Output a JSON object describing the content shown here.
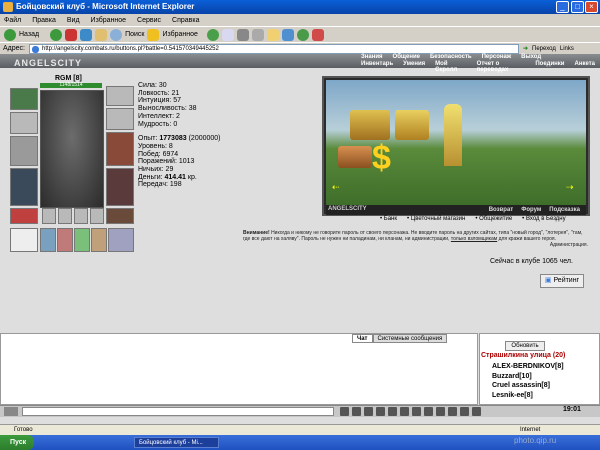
{
  "window": {
    "title": "Бойцовский клуб - Microsoft Internet Explorer"
  },
  "menu": [
    "Файл",
    "Правка",
    "Вид",
    "Избранное",
    "Сервис",
    "Справка"
  ],
  "toolbar": {
    "back": "Назад",
    "search": "Поиск",
    "favorites": "Избранное"
  },
  "address": {
    "label": "Адрес:",
    "url": "http://angelscity.combats.ru/buttons.pl?battle=0.541570349445252",
    "go": "Переход",
    "links": "Links"
  },
  "site": {
    "logo": "ANGELSCITY",
    "nav_top": [
      "Знания",
      "Общение",
      "Безопасность",
      "Персонаж",
      "Выход"
    ],
    "nav_bottom": [
      "Инвентарь",
      "Умения",
      "Мой Скролл",
      "Отчет о переводах",
      "Поединки",
      "Анкета"
    ]
  },
  "character": {
    "name": "RGM [8]",
    "hp": "1148/1514",
    "stats": [
      {
        "label": "Сила:",
        "value": "30"
      },
      {
        "label": "Ловкость:",
        "value": "21"
      },
      {
        "label": "Интуиция:",
        "value": "57"
      },
      {
        "label": "Выносливость:",
        "value": "38"
      },
      {
        "label": "Интеллект:",
        "value": "2"
      },
      {
        "label": "Мудрость:",
        "value": "0"
      }
    ],
    "exp_label": "Опыт:",
    "exp_value": "1773083",
    "exp_next": "(2000000)",
    "level": "Уровень: 8",
    "wins": "Побед: 6974",
    "losses": "Поражений: 1013",
    "draws": "Ничьих: 29",
    "money_label": "Деньги:",
    "money_value": "414.41",
    "money_unit": "кр.",
    "transfers": "Передач: 198"
  },
  "game": {
    "logo": "ANGELSCITY",
    "bar_links": [
      "Возврат",
      "Форум",
      "Подсказка"
    ],
    "links": [
      "Банк",
      "Цветочный магазин",
      "Общежитие",
      "Вход в Бездну"
    ]
  },
  "warning": {
    "bold": "Внимание!",
    "text": "Никогда и никому не говорите пароль от своего персонажа. Не вводите пароль на других сайтах, типа \"новый город\", \"лотерея\", \"там, где все дают на халяву\". Пароль не нужен ни паладинам, ни кланам, ни администрации,",
    "link": "только взломщикам",
    "tail": "для кражи вашего героя.",
    "sign": "Администрация."
  },
  "online": "Сейчас в клубе 1065 чел.",
  "rating_button": "Рейтинг",
  "chat": {
    "tabs": [
      "Чат",
      "Системные сообщения"
    ],
    "refresh": "Обновить",
    "location": "Страшилкина улица (20)",
    "players": [
      "ALEX-BERDNIKOV[8]",
      "Buzzard[10]",
      "Cruel assassin[8]",
      "Lesnik-ee[8]"
    ]
  },
  "clock": "19:01",
  "status": {
    "ready": "Готово",
    "zone": "Internet"
  },
  "taskbar": {
    "start": "Пуск",
    "task": "Бойцовский клуб - Mi..."
  },
  "watermark": "photo.qip.ru"
}
